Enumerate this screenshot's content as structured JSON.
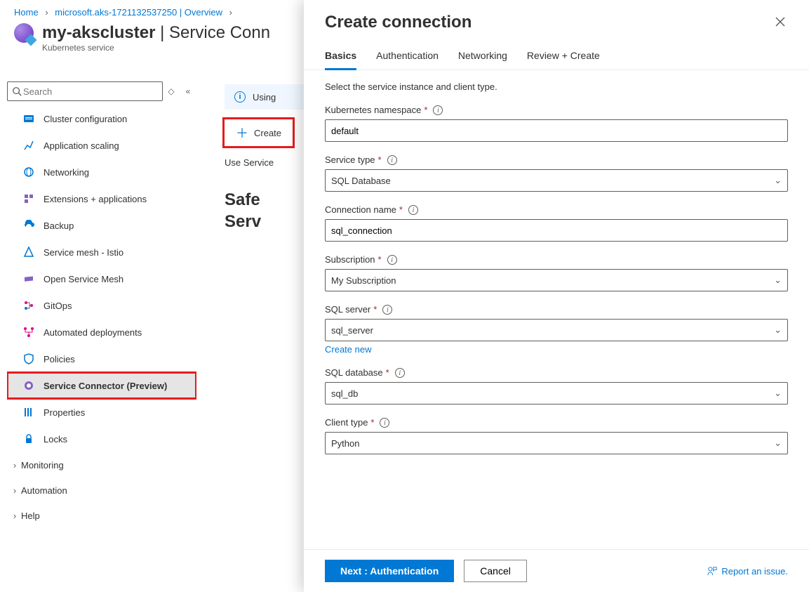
{
  "breadcrumb": {
    "home": "Home",
    "sub": "microsoft.aks-1721132537250 | Overview",
    "sep": "›"
  },
  "page": {
    "title": "my-akscluster",
    "title_suffix": " | Service Conn",
    "subtitle": "Kubernetes service"
  },
  "search": {
    "placeholder": "Search"
  },
  "sidebar": {
    "items": [
      {
        "label": "Cluster configuration",
        "icon": "cluster-config-icon"
      },
      {
        "label": "Application scaling",
        "icon": "scaling-icon"
      },
      {
        "label": "Networking",
        "icon": "networking-icon"
      },
      {
        "label": "Extensions + applications",
        "icon": "extensions-icon"
      },
      {
        "label": "Backup",
        "icon": "backup-icon"
      },
      {
        "label": "Service mesh - Istio",
        "icon": "mesh-istio-icon"
      },
      {
        "label": "Open Service Mesh",
        "icon": "open-mesh-icon"
      },
      {
        "label": "GitOps",
        "icon": "gitops-icon"
      },
      {
        "label": "Automated deployments",
        "icon": "deploy-icon"
      },
      {
        "label": "Policies",
        "icon": "policies-icon"
      },
      {
        "label": "Service Connector (Preview)",
        "icon": "service-connector-icon",
        "selected": true,
        "highlight": true
      },
      {
        "label": "Properties",
        "icon": "properties-icon"
      },
      {
        "label": "Locks",
        "icon": "locks-icon"
      }
    ],
    "groups": [
      {
        "label": "Monitoring"
      },
      {
        "label": "Automation"
      },
      {
        "label": "Help"
      }
    ]
  },
  "main": {
    "info_text": "Using",
    "create_label": "Create",
    "use_text": "Use Service",
    "big_heading_1": "Safe",
    "big_heading_2": "Serv"
  },
  "blade": {
    "title": "Create connection",
    "tabs": [
      "Basics",
      "Authentication",
      "Networking",
      "Review + Create"
    ],
    "help": "Select the service instance and client type.",
    "fields": {
      "namespace": {
        "label": "Kubernetes namespace",
        "value": "default"
      },
      "service_type": {
        "label": "Service type",
        "value": "SQL Database"
      },
      "conn_name": {
        "label": "Connection name",
        "value": "sql_connection"
      },
      "subscription": {
        "label": "Subscription",
        "value": "My Subscription"
      },
      "sql_server": {
        "label": "SQL server",
        "value": "sql_server",
        "link": "Create new"
      },
      "sql_db": {
        "label": "SQL database",
        "value": "sql_db"
      },
      "client_type": {
        "label": "Client type",
        "value": "Python"
      }
    },
    "footer": {
      "next": "Next : Authentication",
      "cancel": "Cancel",
      "report": "Report an issue."
    }
  }
}
